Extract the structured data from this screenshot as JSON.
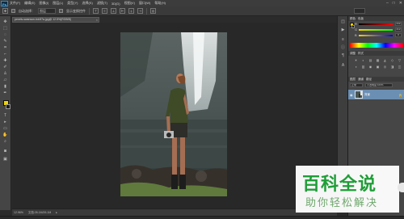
{
  "app": {
    "logo": "Ps"
  },
  "menu": [
    "文件(F)",
    "编辑(E)",
    "图像(I)",
    "图层(L)",
    "类型(Y)",
    "选择(S)",
    "滤镜(T)",
    "3D(D)",
    "视图(V)",
    "窗口(W)",
    "帮助(H)"
  ],
  "window_controls": [
    "–",
    "□",
    "✕"
  ],
  "options": {
    "auto_select_label": "自动选择：",
    "layer_dropdown": "图层",
    "show_transform_label": "显示变换控件"
  },
  "document": {
    "tab_title": "pexels-swanson-bd4f7a.jpg@ 12.5%(RGB/8)",
    "close_glyph": "×",
    "zoom": "12.96%",
    "doc_info": "文档:26.1M/26.1M"
  },
  "panels": {
    "color_tabs": [
      "颜色",
      "色板"
    ],
    "sliders": [
      {
        "label": "R",
        "value": "242",
        "gradient": "linear-gradient(to right,#000,#f00)"
      },
      {
        "label": "G",
        "value": "212",
        "gradient": "linear-gradient(to right,#f2d400,#00ff00)"
      },
      {
        "label": "B",
        "value": "0",
        "gradient": "linear-gradient(to right,#f2d400,#0000ff)"
      }
    ],
    "adjust_tabs": [
      "调整",
      "样式"
    ],
    "adjust_icons": [
      "☀",
      "◐",
      "▤",
      "▦",
      "◭",
      "◇",
      "▽",
      "◑",
      "▥",
      "◉",
      "▣",
      "◎",
      "◨",
      "◫"
    ],
    "layer_tabs": [
      "图层",
      "通道",
      "路径"
    ],
    "blend_mode": "正常",
    "opacity": "不透明度:100%",
    "layer": {
      "name": "背景",
      "lock": "🔒"
    }
  },
  "watermark": {
    "title": "百科全说",
    "subtitle": "助你轻松解决"
  },
  "colors": {
    "foreground": "#f2d400",
    "background": "#1a1a1a",
    "accent": "#1f9e37",
    "selected_layer": "#6b8fb3"
  }
}
